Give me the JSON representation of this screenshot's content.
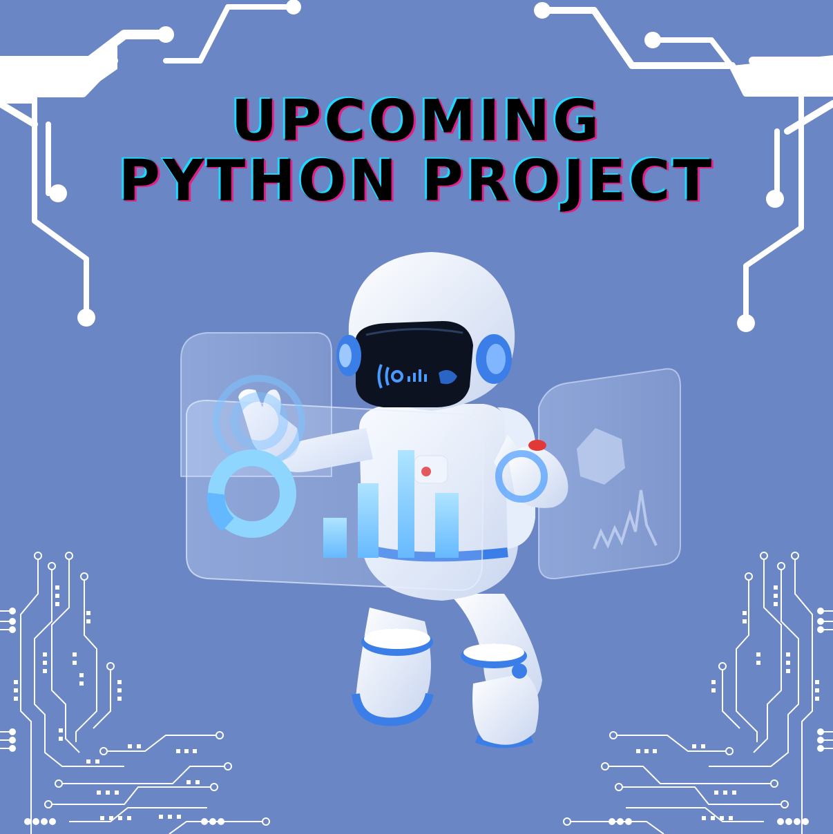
{
  "title": {
    "line1": "UPCOMING",
    "line2": "PYTHON PROJECT"
  },
  "colors": {
    "background": "#6b86c4",
    "circuit": "#ffffff",
    "title_text": "#000000",
    "title_glow_cyan": "#1fd8ff",
    "title_glow_magenta": "#e0218a",
    "accent_blue": "#4a8ff0"
  },
  "illustration": {
    "subject": "astronaut-robot",
    "visor_icons": [
      "sound-wave-icon",
      "bar-chart-icon"
    ],
    "screen_icons": [
      "ring-chart-icon",
      "bar-chart-icon",
      "hexagon-icon",
      "line-wave-icon"
    ]
  }
}
